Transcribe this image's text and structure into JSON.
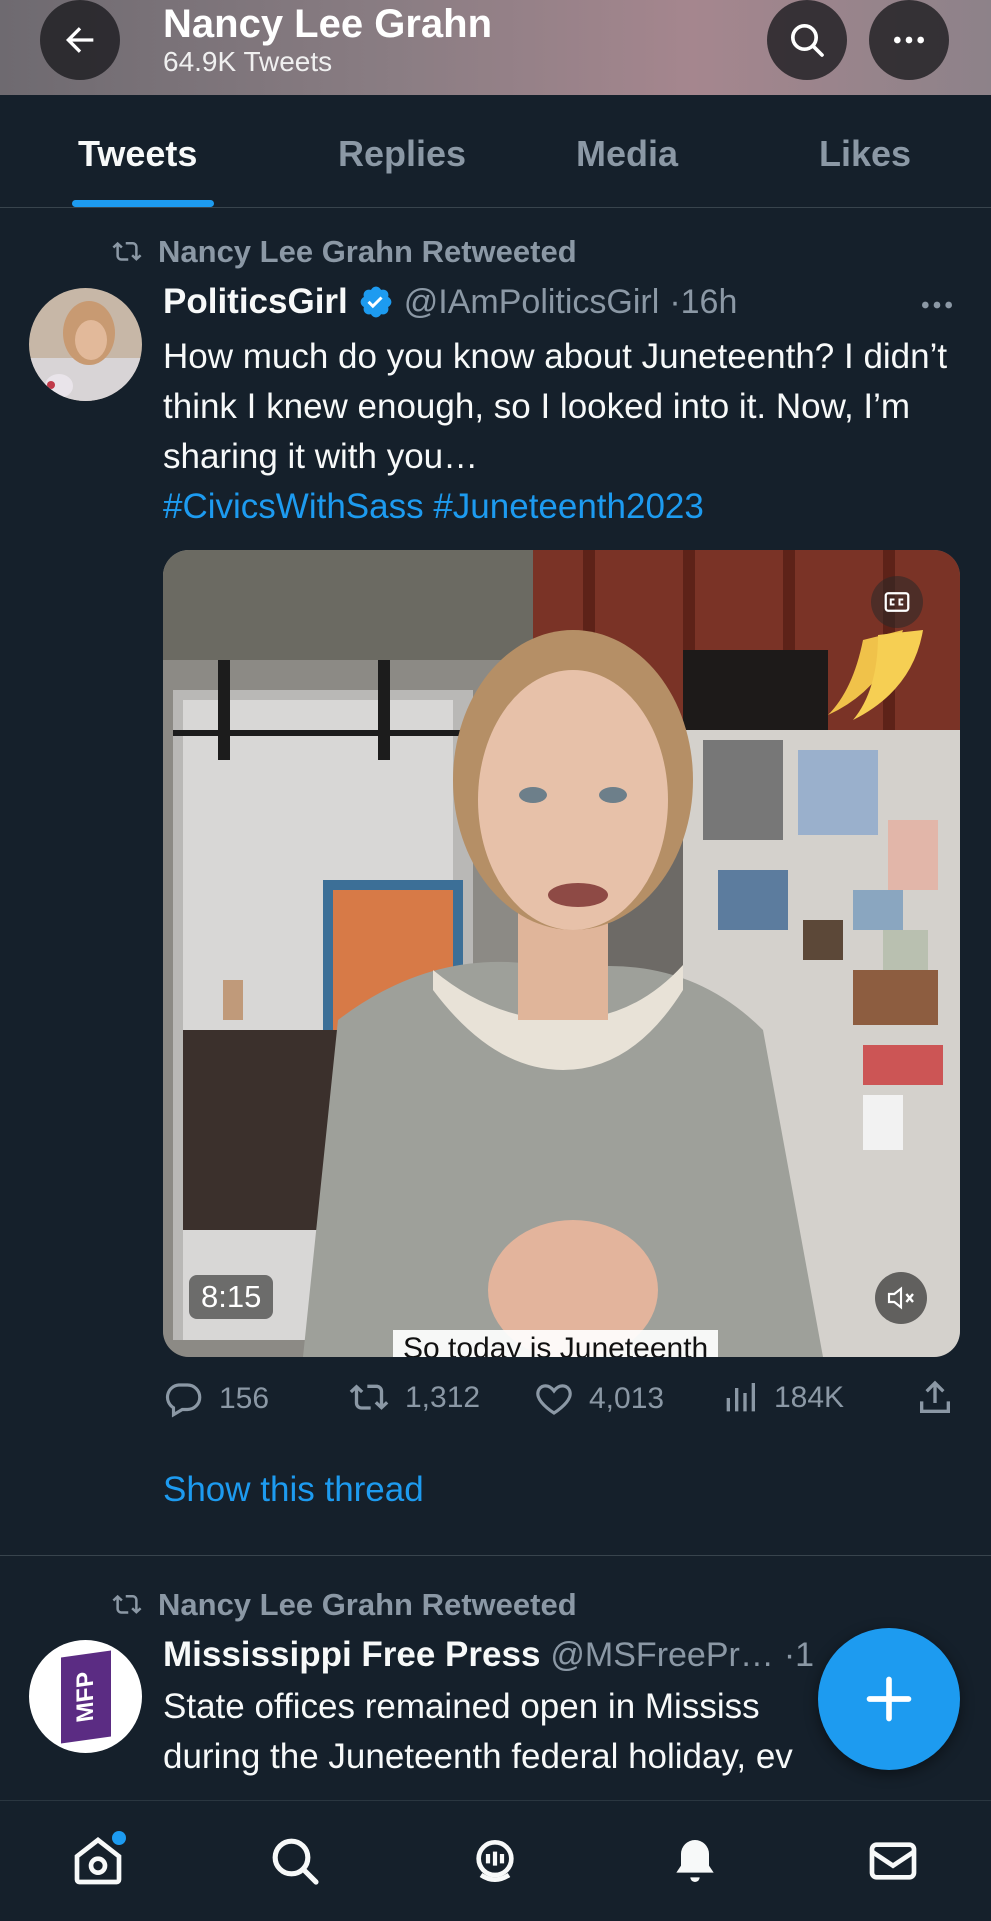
{
  "header": {
    "title": "Nancy Lee Grahn",
    "subtitle": "64.9K Tweets",
    "back_icon": "arrow-left-icon",
    "search_icon": "search-icon",
    "more_icon": "more-horizontal-icon"
  },
  "tabs": [
    {
      "label": "Tweets",
      "active": true
    },
    {
      "label": "Replies",
      "active": false
    },
    {
      "label": "Media",
      "active": false
    },
    {
      "label": "Likes",
      "active": false
    }
  ],
  "tweets": [
    {
      "retweet_label": "Nancy Lee Grahn Retweeted",
      "author_name": "PoliticsGirl",
      "verified": true,
      "handle": "@IAmPoliticsGirl",
      "time": "·16h",
      "text": "How much do you know about Juneteenth? I didn’t think I knew enough, so I looked into it. Now, I’m sharing it with you…",
      "hashtags": "#CivicsWithSass #Juneteenth2023",
      "video": {
        "duration": "8:15",
        "caption": "So today is Juneteenth"
      },
      "stats": {
        "replies": "156",
        "retweets": "1,312",
        "likes": "4,013",
        "views": "184K"
      },
      "show_thread": "Show this thread"
    },
    {
      "retweet_label": "Nancy Lee Grahn Retweeted",
      "author_name": "Mississippi Free Press",
      "handle": "@MSFreePr…",
      "time": "·1",
      "avatar_text": "MFP",
      "text_line1": "State offices remained open in Mississ",
      "text_line2": "during the Juneteenth federal holiday, ev"
    }
  ],
  "colors": {
    "background": "#15202b",
    "accent": "#1d9bf0",
    "muted": "#8b98a5",
    "text": "#f7f9f9",
    "mfp_purple": "#5b2c83"
  },
  "bottom_nav": [
    "home-icon",
    "search-icon",
    "spaces-icon",
    "notifications-icon",
    "messages-icon"
  ]
}
